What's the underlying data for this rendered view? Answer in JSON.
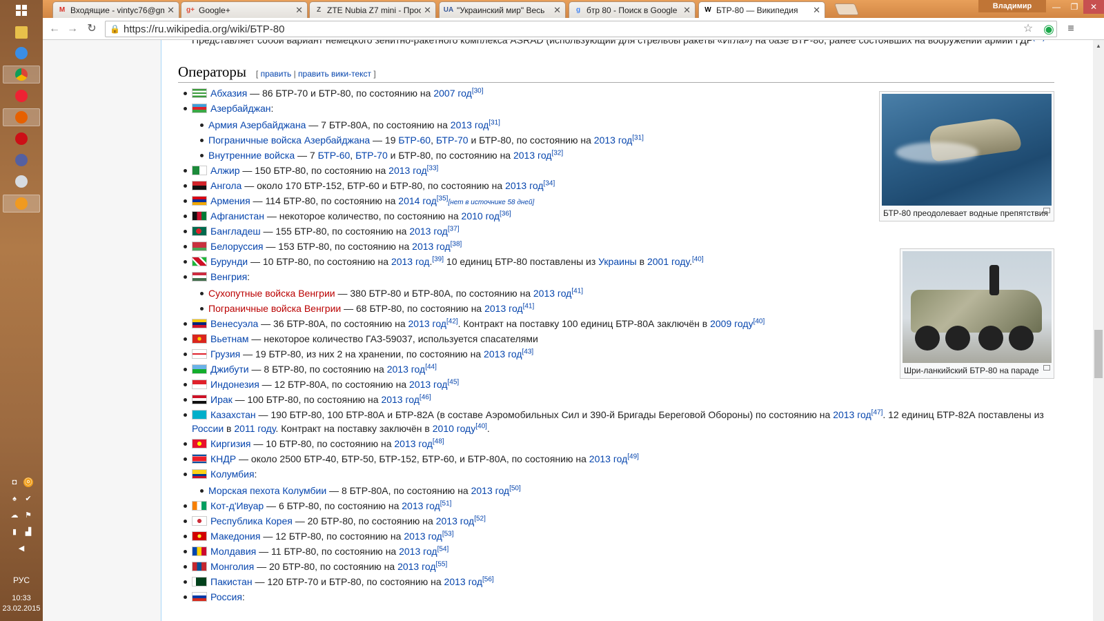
{
  "os": {
    "lang": "РУС",
    "time": "10:33",
    "date": "23.02.2015"
  },
  "browser": {
    "user": "Владимир",
    "tabs": [
      {
        "title": "Входящие - vintyc76@gm",
        "icon": "gmail-icon",
        "fav": "M",
        "color": "#d93025"
      },
      {
        "title": "Google+",
        "icon": "google-plus-icon",
        "fav": "g+",
        "color": "#dd4b39"
      },
      {
        "title": "ZTE Nubia Z7 mini - Прос",
        "icon": "page-icon",
        "fav": "Z",
        "color": "#555"
      },
      {
        "title": "\"Украинский мир\" Весь",
        "icon": "news-icon",
        "fav": "UA",
        "color": "#3a5a9a"
      },
      {
        "title": "бтр 80 - Поиск в Google",
        "icon": "google-icon",
        "fav": "g",
        "color": "#4285f4"
      },
      {
        "title": "БТР-80 — Википедия",
        "icon": "wikipedia-icon",
        "fav": "W",
        "color": "#000"
      }
    ],
    "url": "https://ru.wikipedia.org/wiki/БТР-80"
  },
  "page": {
    "intro": "Представляет собой вариант немецкого зенитно-ракетного комплекса ASRAD (использующий для стрельбы ракеты «Игла») на базе БТР-80, ранее состоявших на вооружении армии ГДР",
    "heading": "Операторы",
    "edit1": "править",
    "edit2": "править вики-текст",
    "images": [
      {
        "caption": "БТР-80 преодолевает водные препятствия"
      },
      {
        "caption": "Шри-ланкийский БТР-80 на параде"
      }
    ]
  }
}
